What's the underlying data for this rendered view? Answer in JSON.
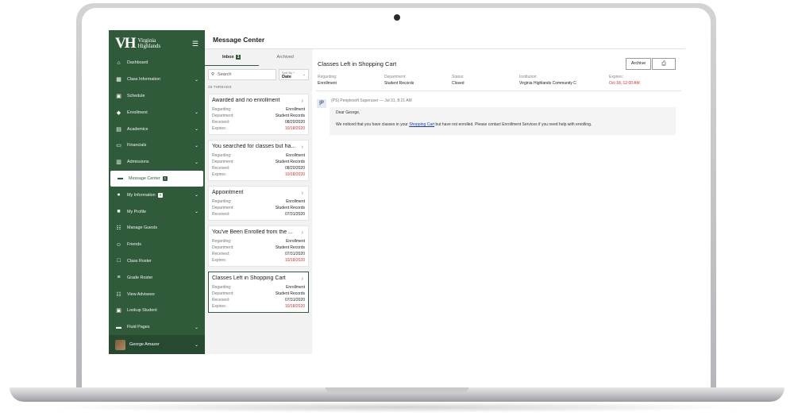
{
  "logo": {
    "mark": "VH",
    "line1": "Virginia",
    "line2": "Highlands"
  },
  "sidebar": {
    "items": [
      {
        "label": "Dashboard",
        "icon": "home-icon",
        "chevron": false
      },
      {
        "label": "Class Information",
        "icon": "table-icon",
        "chevron": true
      },
      {
        "label": "Schedule",
        "icon": "calendar-icon",
        "chevron": false
      },
      {
        "label": "Enrollment",
        "icon": "graduation-cap-icon",
        "chevron": true
      },
      {
        "label": "Academics",
        "icon": "book-icon",
        "chevron": true
      },
      {
        "label": "Financials",
        "icon": "credit-card-icon",
        "chevron": true
      },
      {
        "label": "Admissions",
        "icon": "id-card-icon",
        "chevron": true
      },
      {
        "label": "Message Center",
        "icon": "message-icon",
        "chevron": false,
        "badge": "1",
        "active": true
      },
      {
        "label": "My Information",
        "icon": "info-icon",
        "chevron": true,
        "badge": "0"
      },
      {
        "label": "My Profile",
        "icon": "profile-icon",
        "chevron": true
      },
      {
        "label": "Manage Guests",
        "icon": "guests-icon",
        "chevron": false
      },
      {
        "label": "Friends",
        "icon": "smile-icon",
        "chevron": false
      },
      {
        "label": "Class Roster",
        "icon": "roster-icon",
        "chevron": false
      },
      {
        "label": "Grade Roster",
        "icon": "grade-roster-icon",
        "chevron": false
      },
      {
        "label": "View Advisees",
        "icon": "advisees-icon",
        "chevron": false
      },
      {
        "label": "Lookup Student",
        "icon": "lookup-icon",
        "chevron": false
      },
      {
        "label": "Fluid Pages",
        "icon": "folder-icon",
        "chevron": true
      }
    ],
    "user": {
      "name": "George Amazer"
    }
  },
  "header": {
    "title": "Message Center"
  },
  "threads": {
    "tabs": [
      {
        "label": "Inbox",
        "count": "1"
      },
      {
        "label": "Archived"
      }
    ],
    "search_placeholder": "Search",
    "sort_label": "Sort By *",
    "sort_value": "Date",
    "count_label": "25 THREADS",
    "labels": {
      "regarding": "Regarding:",
      "department": "Department:",
      "received": "Received:",
      "expires": "Expires:"
    },
    "cards": [
      {
        "title": "Awarded and no enrollment",
        "regarding": "Enrollment",
        "department": "Student Records",
        "received": "08/20/2020",
        "expires": "10/18/2020"
      },
      {
        "title": "You searched for classes but ha...",
        "regarding": "Enrollment",
        "department": "Student Records",
        "received": "08/20/2020",
        "expires": "10/18/2020"
      },
      {
        "title": "Appointment",
        "regarding": "Enrollment",
        "department": "Student Records",
        "received": "07/31/2020"
      },
      {
        "title": "You've Been Enrolled from the ...",
        "regarding": "Enrollment",
        "department": "Student Records",
        "received": "07/31/2020",
        "expires": "10/18/2020"
      },
      {
        "title": "Classes Left in Shopping Cart",
        "regarding": "Enrollment",
        "department": "Student Records",
        "received": "07/31/2020",
        "expires": "10/18/2020",
        "selected": true
      }
    ]
  },
  "message": {
    "title": "Classes Left in Shopping Cart",
    "archive_label": "Archive",
    "meta": [
      {
        "label": "Regarding:",
        "value": "Enrollment"
      },
      {
        "label": "Department:",
        "value": "Student Records"
      },
      {
        "label": "Status:",
        "value": "Closed"
      },
      {
        "label": "Institution:",
        "value": "Virginia Highlands Community C"
      },
      {
        "label": "Expires:",
        "value": "Oct 18, 12:00 AM"
      }
    ],
    "sender_initials": "|P",
    "sender_line": "(PS) Peoplesoft Superuser — Jul 31, 8:21 AM",
    "greeting": "Dear George,",
    "body_before": "We noticed that you have classes in your ",
    "body_link": "Shopping Cart",
    "body_after": " but have not enrolled. Please contact Enrollment Services if you need help with enrolling."
  },
  "colors": {
    "brand_green": "#2f5b3b",
    "expires_red": "#d32f2f",
    "link_blue": "#1a3fb5"
  }
}
